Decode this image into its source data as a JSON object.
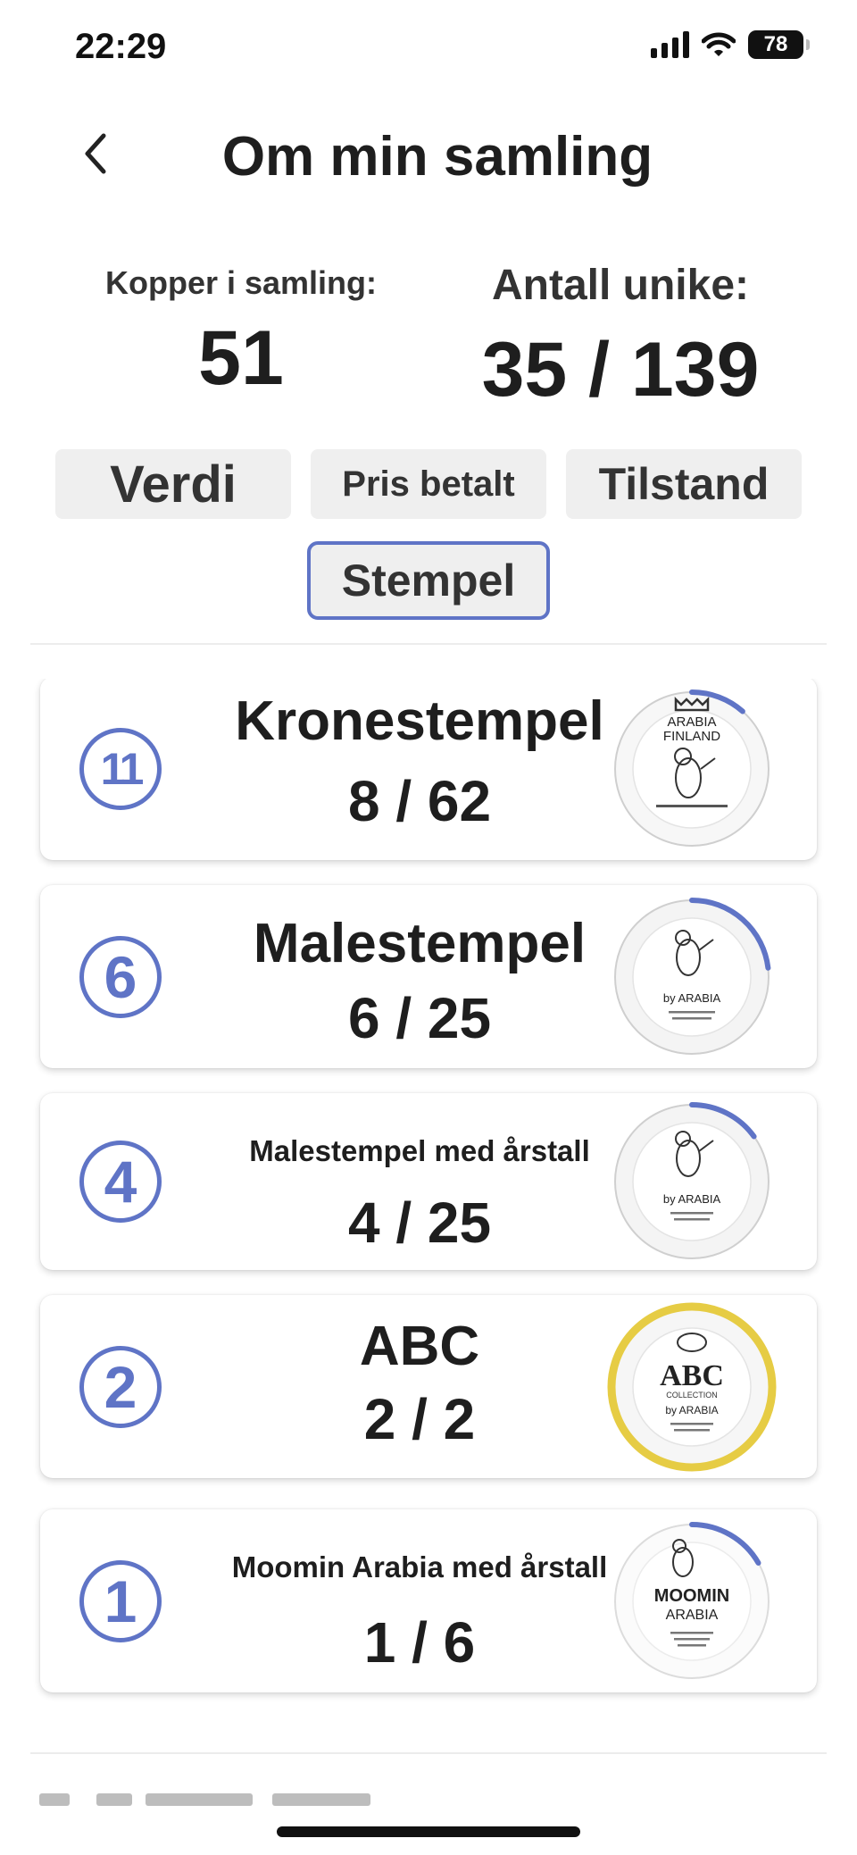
{
  "status_bar": {
    "time": "22:29",
    "battery": "78",
    "icons": [
      "signal-icon",
      "wifi-icon",
      "battery-icon"
    ]
  },
  "header": {
    "title": "Om min samling",
    "back_icon": "chevron-left-icon"
  },
  "stats": {
    "copies_label": "Kopper i samling:",
    "copies_value": "51",
    "unique_label": "Antall unike:",
    "unique_value": "35 / 139"
  },
  "filters": [
    {
      "label": "Verdi",
      "selected": false
    },
    {
      "label": "Pris betalt",
      "selected": false
    },
    {
      "label": "Tilstand",
      "selected": false
    },
    {
      "label": "Stempel",
      "selected": true
    }
  ],
  "accent_color": "#5f74c6",
  "highlight_color": "#e6cc44",
  "stamps": [
    {
      "badge": "11",
      "name": "Kronestempel",
      "count": "8 / 62",
      "owned": 8,
      "total": 62,
      "plate_text": [
        "ARABIA",
        "FINLAND"
      ]
    },
    {
      "badge": "6",
      "name": "Malestempel",
      "count": "6 / 25",
      "owned": 6,
      "total": 25,
      "plate_text": [
        "by ARABIA"
      ]
    },
    {
      "badge": "4",
      "name": "Malestempel med årstall",
      "count": "4 / 25",
      "owned": 4,
      "total": 25,
      "plate_text": [
        "by ARABIA"
      ]
    },
    {
      "badge": "2",
      "name": "ABC",
      "count": "2 / 2",
      "owned": 2,
      "total": 2,
      "complete": true,
      "plate_text": [
        "ABC",
        "COLLECTION",
        "by ARABIA"
      ]
    },
    {
      "badge": "1",
      "name": "Moomin Arabia med årstall",
      "count": "1 / 6",
      "owned": 1,
      "total": 6,
      "plate_text": [
        "MOOMIN",
        "ARABIA"
      ]
    }
  ]
}
